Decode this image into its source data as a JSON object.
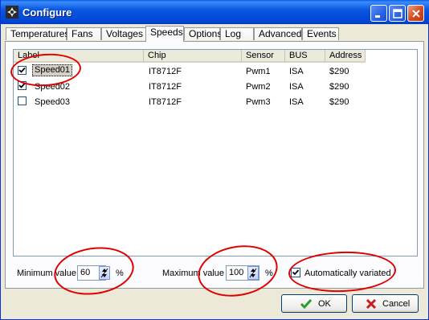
{
  "window": {
    "title": "Configure",
    "minimize_symbol": "_",
    "maximize_symbol": "□",
    "close_symbol": "×"
  },
  "tabs": [
    {
      "label": "Temperatures",
      "active": false
    },
    {
      "label": "Fans",
      "active": false
    },
    {
      "label": "Voltages",
      "active": false
    },
    {
      "label": "Speeds",
      "active": true
    },
    {
      "label": "Options",
      "active": false
    },
    {
      "label": "Log",
      "active": false
    },
    {
      "label": "Advanced",
      "active": false
    },
    {
      "label": "Events",
      "active": false
    }
  ],
  "table": {
    "columns": [
      "Label",
      "Chip",
      "Sensor",
      "BUS",
      "Address"
    ],
    "rows": [
      {
        "checked": true,
        "label": "Speed01",
        "chip": "IT8712F",
        "sensor": "Pwm1",
        "bus": "ISA",
        "address": "$290",
        "selected": true
      },
      {
        "checked": true,
        "label": "Speed02",
        "chip": "IT8712F",
        "sensor": "Pwm2",
        "bus": "ISA",
        "address": "$290",
        "selected": false
      },
      {
        "checked": false,
        "label": "Speed03",
        "chip": "IT8712F",
        "sensor": "Pwm3",
        "bus": "ISA",
        "address": "$290",
        "selected": false
      }
    ]
  },
  "controls": {
    "min_label": "Minimum value",
    "min_value": "60",
    "min_unit": "%",
    "max_label": "Maximum value",
    "max_value": "100",
    "max_unit": "%",
    "auto_label": "Automatically variated",
    "auto_checked": true
  },
  "buttons": {
    "ok": "OK",
    "cancel": "Cancel"
  },
  "colors": {
    "annotation": "#e00000",
    "titlebar": "#0a57e0",
    "ok_icon": "#2a9d2a",
    "cancel_icon": "#c8201c"
  }
}
